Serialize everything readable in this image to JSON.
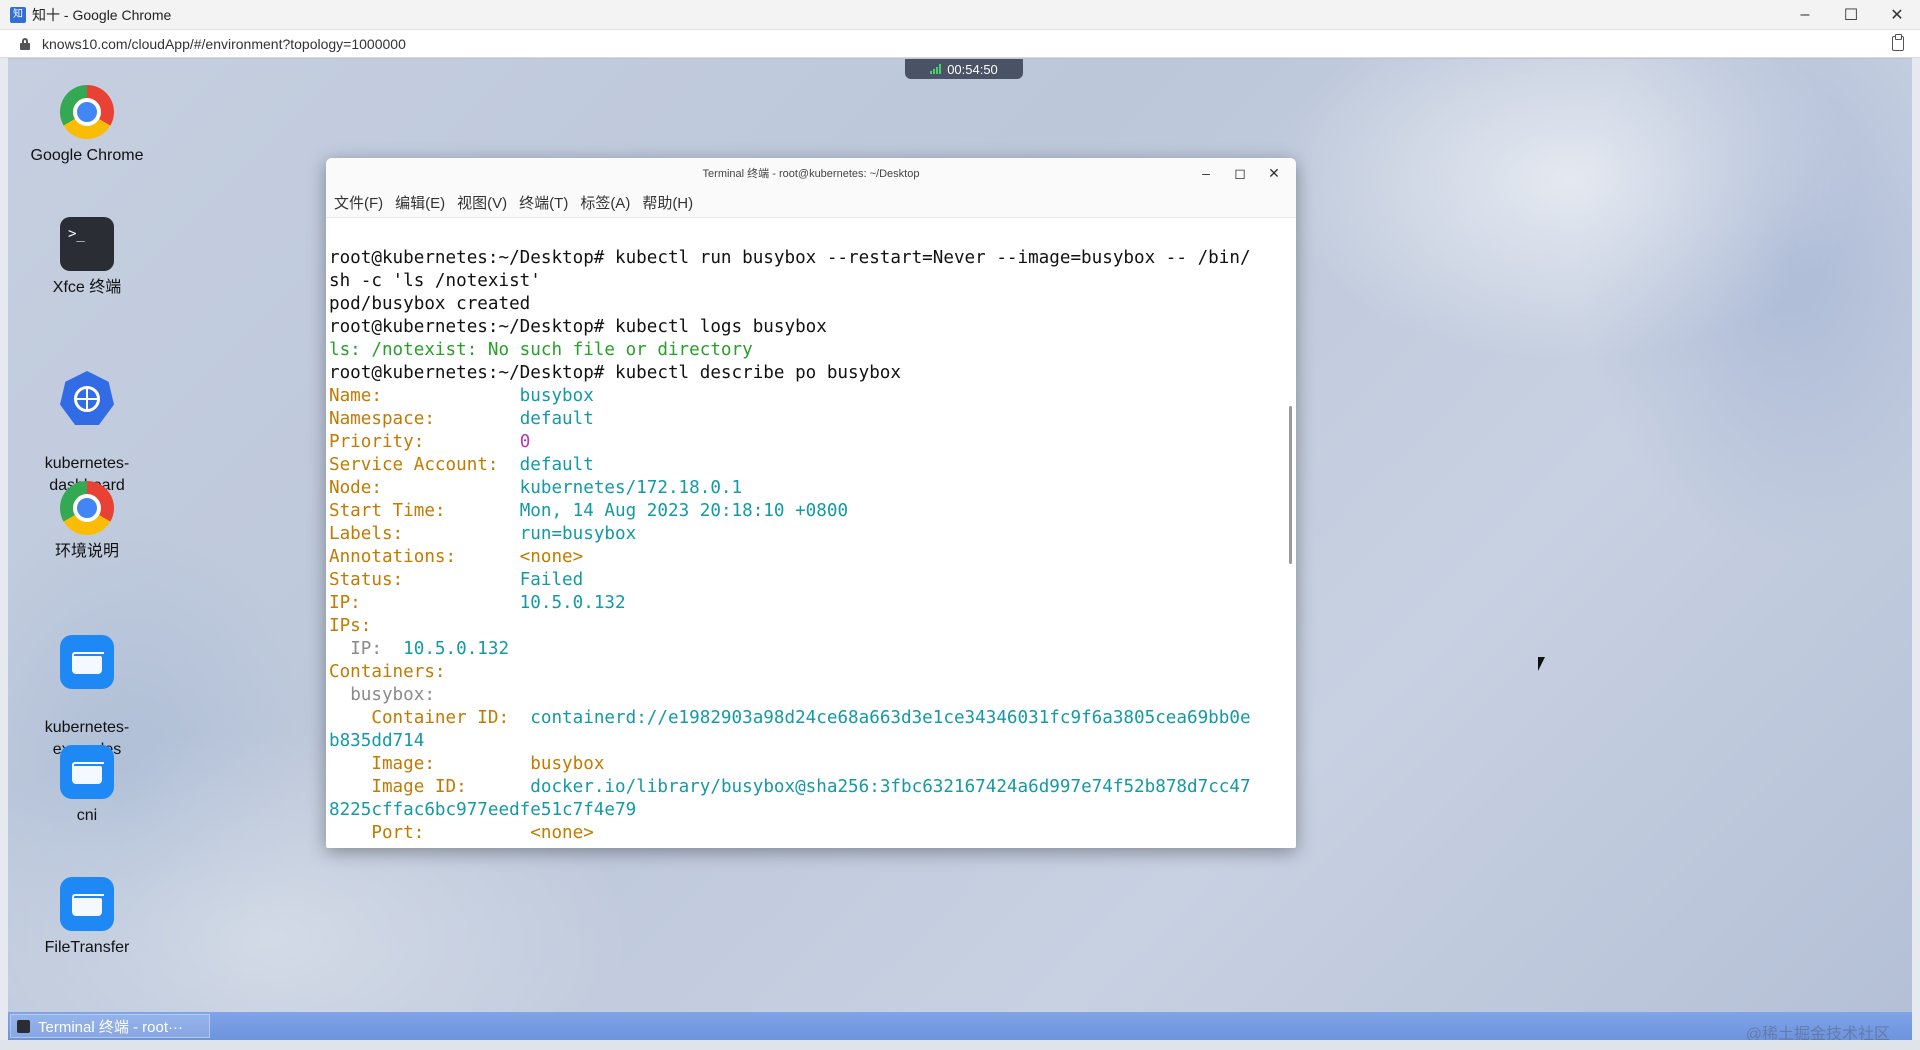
{
  "browser": {
    "favicon": "知",
    "title": "知十 - Google Chrome",
    "url": "knows10.com/cloudApp/#/environment?topology=1000000",
    "controls": {
      "minimize": "–",
      "maximize": "☐",
      "close": "✕"
    }
  },
  "session": {
    "timer": "00:54:50"
  },
  "desktop_icons": [
    {
      "label": "Google Chrome",
      "icon": "chrome-icon"
    },
    {
      "label": "Xfce 终端",
      "icon": "terminal-icon",
      "glyph": ">_"
    },
    {
      "label": "kubernetes-\ndashboard",
      "icon": "kubernetes-icon"
    },
    {
      "label": "环境说明",
      "icon": "chrome-icon"
    },
    {
      "label": "kubernetes-\nexamples",
      "icon": "folder-icon"
    },
    {
      "label": "cni",
      "icon": "folder-icon"
    },
    {
      "label": "FileTransfer",
      "icon": "folder-icon"
    }
  ],
  "terminal": {
    "title": "Terminal 终端 - root@kubernetes: ~/Desktop",
    "controls": {
      "minimize": "–",
      "maximize": "◻",
      "close": "✕"
    },
    "menu": [
      "文件(F)",
      "编辑(E)",
      "视图(V)",
      "终端(T)",
      "标签(A)",
      "帮助(H)"
    ],
    "lines": {
      "l1": "root@kubernetes:~/Desktop# kubectl run busybox --restart=Never --image=busybox -- /bin/",
      "l2": "sh -c 'ls /notexist'",
      "l3": "pod/busybox created",
      "l4": "root@kubernetes:~/Desktop# kubectl logs busybox",
      "l5": "ls: /notexist: No such file or directory",
      "l6": "root@kubernetes:~/Desktop# kubectl describe po busybox"
    },
    "describe": {
      "name_k": "Name:",
      "name_v": "busybox",
      "ns_k": "Namespace:",
      "ns_v": "default",
      "prio_k": "Priority:",
      "prio_v": "0",
      "sa_k": "Service Account:",
      "sa_v": "default",
      "node_k": "Node:",
      "node_v": "kubernetes/172.18.0.1",
      "start_k": "Start Time:",
      "start_v": "Mon, 14 Aug 2023 20:18:10 +0800",
      "labels_k": "Labels:",
      "labels_v": "run=busybox",
      "ann_k": "Annotations:",
      "ann_v": "<none>",
      "status_k": "Status:",
      "status_v": "Failed",
      "ip_k": "IP:",
      "ip_v": "10.5.0.132",
      "ips_k": "IPs:",
      "ips_ip_k": "IP:",
      "ips_ip_v": "10.5.0.132",
      "containers_k": "Containers:",
      "container_name": "busybox:",
      "cid_k": "Container ID:",
      "cid_v": "containerd://e1982903a98d24ce68a663d3e1ce34346031fc9f6a3805cea69bb0e",
      "cid_v2": "b835dd714",
      "image_k": "Image:",
      "image_v": "busybox",
      "imageid_k": "Image ID:",
      "imageid_v": "docker.io/library/busybox@sha256:3fbc632167424a6d997e74f52b878d7cc47",
      "imageid_v2": "8225cffac6bc977eedfe51c7f4e79",
      "port_k": "Port:",
      "port_v": "<none>"
    }
  },
  "taskbar": {
    "item": "Terminal 终端 - root···"
  },
  "watermark": "@稀土掘金技术社区"
}
